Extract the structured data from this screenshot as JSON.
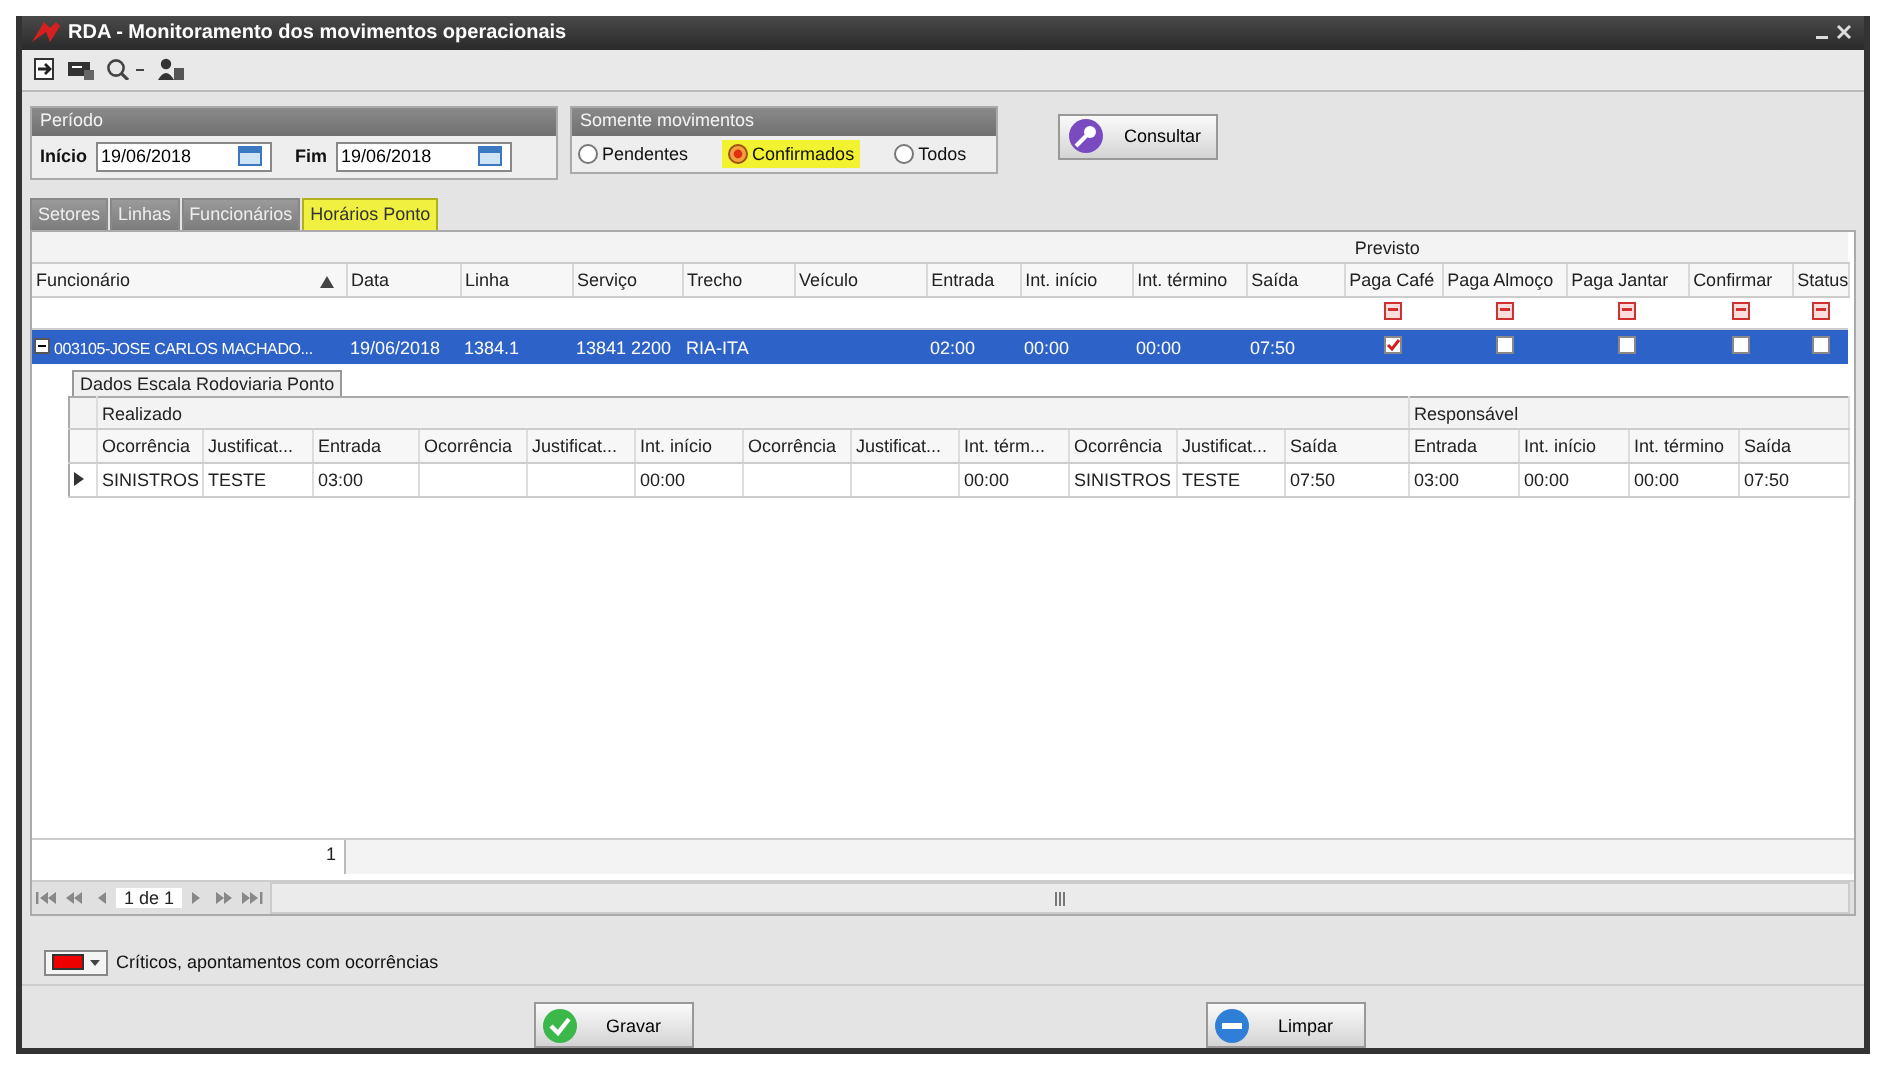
{
  "window": {
    "title": "RDA - Monitoramento dos movimentos operacionais"
  },
  "periodo": {
    "title": "Período",
    "inicio_label": "Início",
    "inicio": "19/06/2018",
    "fim_label": "Fim",
    "fim": "19/06/2018"
  },
  "movimentos": {
    "title": "Somente movimentos",
    "options": [
      {
        "label": "Pendentes",
        "selected": false
      },
      {
        "label": "Confirmados",
        "selected": true
      },
      {
        "label": "Todos",
        "selected": false
      }
    ]
  },
  "consultar": "Consultar",
  "tabs": [
    {
      "label": "Setores",
      "selected": false
    },
    {
      "label": "Linhas",
      "selected": false
    },
    {
      "label": "Funcionários",
      "selected": false
    },
    {
      "label": "Horários Ponto",
      "selected": true
    }
  ],
  "grid": {
    "band": "Previsto",
    "columns": [
      "Funcionário",
      "Data",
      "Linha",
      "Serviço",
      "Trecho",
      "Veículo",
      "Entrada",
      "Int. início",
      "Int. término",
      "Saída",
      "Paga Café",
      "Paga Almoço",
      "Paga Jantar",
      "Confirmar",
      "Status"
    ],
    "rows": [
      {
        "expanded": true,
        "selected": true,
        "cells": [
          "003105-JOSE CARLOS MACHADO...",
          "19/06/2018",
          "1384.1",
          "13841 2200",
          "RIA-ITA",
          "",
          "02:00",
          "00:00",
          "00:00",
          "07:50"
        ],
        "checks": [
          true,
          false,
          false,
          false,
          false
        ]
      }
    ],
    "detail": {
      "tab": "Dados Escala Rodoviaria Ponto",
      "bands": [
        "Realizado",
        "Responsável"
      ],
      "columns": [
        "Ocorrência",
        "Justificat...",
        "Entrada",
        "Ocorrência",
        "Justificat...",
        "Int. início",
        "Ocorrência",
        "Justificat...",
        "Int. térm...",
        "Ocorrência",
        "Justificat...",
        "Saída",
        "Entrada",
        "Int. início",
        "Int. término",
        "Saída"
      ],
      "rows": [
        {
          "cells": [
            "SINISTROS",
            "TESTE",
            "03:00",
            "",
            "",
            "00:00",
            "",
            "",
            "00:00",
            "SINISTROS",
            "TESTE",
            "07:50",
            "03:00",
            "00:00",
            "00:00",
            "07:50"
          ]
        }
      ]
    },
    "summary": "1",
    "pager": "1 de 1"
  },
  "legend": "Críticos, apontamentos com ocorrências",
  "buttons": [
    {
      "label": "Gravar",
      "kind": "save"
    },
    {
      "label": "Limpar",
      "kind": "clear"
    }
  ]
}
